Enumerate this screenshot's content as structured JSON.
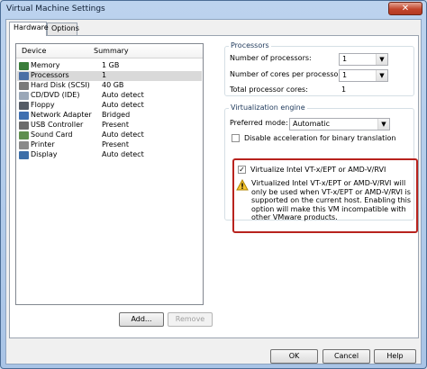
{
  "window": {
    "title": "Virtual Machine Settings",
    "close_label": "✕"
  },
  "tabs": [
    {
      "label": "Hardware"
    },
    {
      "label": "Options"
    }
  ],
  "device_list": {
    "col_device": "Device",
    "col_summary": "Summary",
    "rows": [
      {
        "name": "Memory",
        "summary": "1 GB",
        "icon": "memory-icon",
        "color": "#3a7d3a"
      },
      {
        "name": "Processors",
        "summary": "1",
        "icon": "processor-icon",
        "color": "#4a6fa5"
      },
      {
        "name": "Hard Disk (SCSI)",
        "summary": "40 GB",
        "icon": "hard-disk-icon",
        "color": "#7a7a7a"
      },
      {
        "name": "CD/DVD (IDE)",
        "summary": "Auto detect",
        "icon": "cd-dvd-icon",
        "color": "#9aa7b8"
      },
      {
        "name": "Floppy",
        "summary": "Auto detect",
        "icon": "floppy-icon",
        "color": "#555c66"
      },
      {
        "name": "Network Adapter",
        "summary": "Bridged",
        "icon": "network-adapter-icon",
        "color": "#3f6fb0"
      },
      {
        "name": "USB Controller",
        "summary": "Present",
        "icon": "usb-icon",
        "color": "#6b6b6b"
      },
      {
        "name": "Sound Card",
        "summary": "Auto detect",
        "icon": "sound-card-icon",
        "color": "#5f8f4f"
      },
      {
        "name": "Printer",
        "summary": "Present",
        "icon": "printer-icon",
        "color": "#8a8a8a"
      },
      {
        "name": "Display",
        "summary": "Auto detect",
        "icon": "display-icon",
        "color": "#3c6ea8"
      }
    ],
    "selected_index": 1
  },
  "buttons": {
    "add": "Add...",
    "remove": "Remove",
    "ok": "OK",
    "cancel": "Cancel",
    "help": "Help"
  },
  "processors": {
    "group_label": "Processors",
    "num_processors_label": "Number of processors:",
    "num_processors_value": "1",
    "num_cores_label": "Number of cores per processor:",
    "num_cores_value": "1",
    "total_cores_label": "Total processor cores:",
    "total_cores_value": "1"
  },
  "virtualization": {
    "group_label": "Virtualization engine",
    "preferred_mode_label": "Preferred mode:",
    "preferred_mode_value": "Automatic",
    "disable_accel_label": "Disable acceleration for binary translation",
    "disable_accel_checked": false,
    "vtx_label": "Virtualize Intel VT-x/EPT or AMD-V/RVI",
    "vtx_checked": true,
    "warning_text": "Virtualized Intel VT-x/EPT or AMD-V/RVI will only be used when VT-x/EPT or AMD-V/RVI is supported on the current host. Enabling this option will make this VM incompatible with other VMware products."
  },
  "colors": {
    "highlight_border": "#b8231e",
    "selected_row": "#d9d9d9",
    "titlebar": "#bcd3ee"
  }
}
